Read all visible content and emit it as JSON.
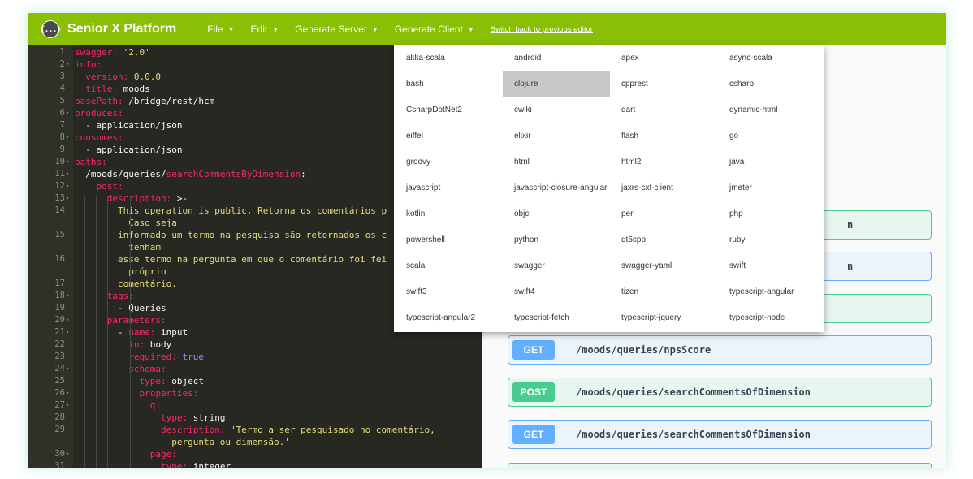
{
  "app": {
    "title": "Senior X Platform",
    "logo_glyph": "{...}"
  },
  "menu": {
    "items": [
      {
        "label": "File",
        "caret": "▼"
      },
      {
        "label": "Edit",
        "caret": "▼"
      },
      {
        "label": "Generate Server",
        "caret": "▼"
      },
      {
        "label": "Generate Client",
        "caret": "▼"
      }
    ],
    "switch_link": "Switch back to previous editor"
  },
  "colors": {
    "topbar": "#89bf04",
    "get": "#61affe",
    "post": "#49cc90",
    "editor_bg": "#272822"
  },
  "editor": {
    "lines": [
      {
        "n": "1",
        "f": false,
        "t": [
          [
            "k",
            "swagger: "
          ],
          [
            "s",
            "'2.0'"
          ]
        ]
      },
      {
        "n": "2",
        "f": true,
        "t": [
          [
            "k",
            "info:"
          ]
        ]
      },
      {
        "n": "3",
        "f": false,
        "t": [
          [
            "v",
            "  "
          ],
          [
            "k",
            "version: "
          ],
          [
            "s",
            "0.0.0"
          ]
        ]
      },
      {
        "n": "4",
        "f": false,
        "t": [
          [
            "v",
            "  "
          ],
          [
            "k",
            "title: "
          ],
          [
            "v",
            "moods"
          ]
        ]
      },
      {
        "n": "5",
        "f": false,
        "t": [
          [
            "k",
            "basePath: "
          ],
          [
            "v",
            "/bridge/rest/hcm"
          ]
        ]
      },
      {
        "n": "6",
        "f": true,
        "t": [
          [
            "k",
            "produces:"
          ]
        ]
      },
      {
        "n": "7",
        "f": false,
        "t": [
          [
            "v",
            "  - application/json"
          ]
        ]
      },
      {
        "n": "8",
        "f": true,
        "t": [
          [
            "k",
            "consumes:"
          ]
        ]
      },
      {
        "n": "9",
        "f": false,
        "t": [
          [
            "v",
            "  - application/json"
          ]
        ]
      },
      {
        "n": "10",
        "f": true,
        "t": [
          [
            "k",
            "paths:"
          ]
        ]
      },
      {
        "n": "11",
        "f": true,
        "t": [
          [
            "v",
            "  /moods/queries/"
          ],
          [
            "k",
            "searchCommentsByDimension"
          ],
          [
            "v",
            ":"
          ]
        ]
      },
      {
        "n": "12",
        "f": true,
        "t": [
          [
            "v",
            "    "
          ],
          [
            "k",
            "post:"
          ]
        ]
      },
      {
        "n": "13",
        "f": true,
        "t": [
          [
            "v",
            "      "
          ],
          [
            "k",
            "description: "
          ],
          [
            "v",
            ">-"
          ]
        ]
      },
      {
        "n": "14",
        "f": false,
        "t": [
          [
            "s",
            "        This operation is public. Retorna os comentários p"
          ]
        ]
      },
      {
        "n": "",
        "f": false,
        "t": [
          [
            "s",
            "          Caso seja"
          ]
        ]
      },
      {
        "n": "15",
        "f": false,
        "t": [
          [
            "s",
            "        informado um termo na pesquisa são retornados os c"
          ]
        ]
      },
      {
        "n": "",
        "f": false,
        "t": [
          [
            "s",
            "          tenham"
          ]
        ]
      },
      {
        "n": "16",
        "f": false,
        "t": [
          [
            "s",
            "        esse termo na pergunta em que o comentário foi fei"
          ]
        ]
      },
      {
        "n": "",
        "f": false,
        "t": [
          [
            "s",
            "          próprio"
          ]
        ]
      },
      {
        "n": "17",
        "f": false,
        "t": [
          [
            "s",
            "        comentário."
          ]
        ]
      },
      {
        "n": "18",
        "f": true,
        "t": [
          [
            "v",
            "      "
          ],
          [
            "k",
            "tags:"
          ]
        ]
      },
      {
        "n": "19",
        "f": false,
        "t": [
          [
            "v",
            "        - Queries"
          ]
        ]
      },
      {
        "n": "20",
        "f": true,
        "t": [
          [
            "v",
            "      "
          ],
          [
            "k",
            "parameters:"
          ]
        ]
      },
      {
        "n": "21",
        "f": true,
        "t": [
          [
            "v",
            "        - "
          ],
          [
            "k",
            "name: "
          ],
          [
            "v",
            "input"
          ]
        ]
      },
      {
        "n": "22",
        "f": false,
        "t": [
          [
            "v",
            "          "
          ],
          [
            "k",
            "in: "
          ],
          [
            "v",
            "body"
          ]
        ]
      },
      {
        "n": "23",
        "f": false,
        "t": [
          [
            "v",
            "          "
          ],
          [
            "k",
            "required: "
          ],
          [
            "n",
            "true"
          ]
        ]
      },
      {
        "n": "24",
        "f": true,
        "t": [
          [
            "v",
            "          "
          ],
          [
            "k",
            "schema:"
          ]
        ]
      },
      {
        "n": "25",
        "f": false,
        "t": [
          [
            "v",
            "            "
          ],
          [
            "k",
            "type: "
          ],
          [
            "v",
            "object"
          ]
        ]
      },
      {
        "n": "26",
        "f": true,
        "t": [
          [
            "v",
            "            "
          ],
          [
            "k",
            "properties:"
          ]
        ]
      },
      {
        "n": "27",
        "f": true,
        "t": [
          [
            "v",
            "              "
          ],
          [
            "k",
            "q:"
          ]
        ]
      },
      {
        "n": "28",
        "f": false,
        "t": [
          [
            "v",
            "                "
          ],
          [
            "k",
            "type: "
          ],
          [
            "v",
            "string"
          ]
        ]
      },
      {
        "n": "29",
        "f": false,
        "t": [
          [
            "v",
            "                "
          ],
          [
            "k",
            "description: "
          ],
          [
            "s",
            "'Termo a ser pesquisado no comentário,"
          ]
        ]
      },
      {
        "n": "",
        "f": false,
        "t": [
          [
            "s",
            "                  pergunta ou dimensão.'"
          ]
        ]
      },
      {
        "n": "30",
        "f": true,
        "t": [
          [
            "v",
            "              "
          ],
          [
            "k",
            "page:"
          ]
        ]
      },
      {
        "n": "31",
        "f": false,
        "t": [
          [
            "v",
            "                "
          ],
          [
            "k",
            "type: "
          ],
          [
            "v",
            "integer"
          ]
        ]
      }
    ]
  },
  "operations": [
    {
      "method": "",
      "path": "",
      "cls": "post",
      "frag": "n"
    },
    {
      "method": "",
      "path": "",
      "cls": "get",
      "frag": "n"
    },
    {
      "method": "",
      "path": "",
      "cls": "post",
      "frag": ""
    },
    {
      "method": "GET",
      "path": "/moods/queries/npsScore",
      "cls": "get",
      "frag": ""
    },
    {
      "method": "POST",
      "path": "/moods/queries/searchCommentsOfDimension",
      "cls": "post",
      "frag": ""
    },
    {
      "method": "GET",
      "path": "/moods/queries/searchCommentsOfDimension",
      "cls": "get",
      "frag": ""
    },
    {
      "method": "",
      "path": "",
      "cls": "post",
      "frag": ""
    }
  ],
  "client_menu": {
    "highlighted": "clojure",
    "items": [
      "akka-scala",
      "android",
      "apex",
      "async-scala",
      "bash",
      "clojure",
      "cpprest",
      "csharp",
      "CsharpDotNet2",
      "cwiki",
      "dart",
      "dynamic-html",
      "eiffel",
      "elixir",
      "flash",
      "go",
      "groovy",
      "html",
      "html2",
      "java",
      "javascript",
      "javascript-closure-angular",
      "jaxrs-cxf-client",
      "jmeter",
      "kotlin",
      "objc",
      "perl",
      "php",
      "powershell",
      "python",
      "qt5cpp",
      "ruby",
      "scala",
      "swagger",
      "swagger-yaml",
      "swift",
      "swift3",
      "swift4",
      "tizen",
      "typescript-angular",
      "typescript-angular2",
      "typescript-fetch",
      "typescript-jquery",
      "typescript-node"
    ]
  }
}
